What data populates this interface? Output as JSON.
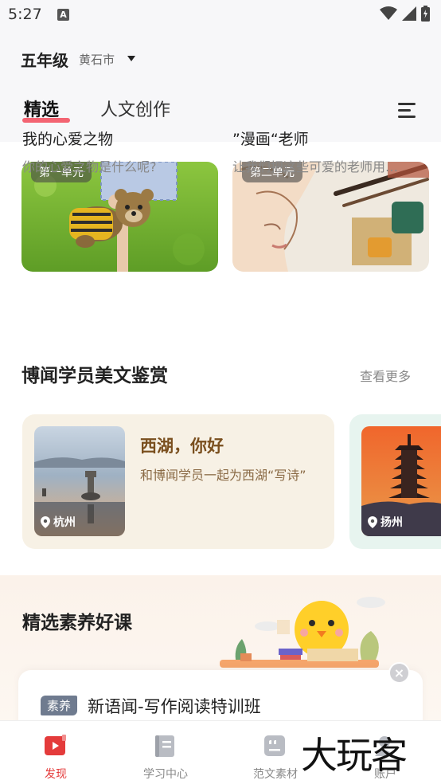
{
  "status_bar": {
    "time": "5:27",
    "notif_glyph": "A",
    "icons": [
      "wifi-icon",
      "signal-icon",
      "battery-icon"
    ]
  },
  "header": {
    "grade": "五年级",
    "city": "黄石市",
    "tabs": [
      {
        "label": "精选",
        "active": true
      },
      {
        "label": "人文创作",
        "active": false
      }
    ]
  },
  "units": [
    {
      "badge": "第一单元",
      "title": "我的心爱之物",
      "subtitle": "你的心爱之物是什么呢?"
    },
    {
      "badge": "第二单元",
      "title": "”漫画“老师",
      "subtitle": "让我们把这些可爱的老师用…"
    }
  ],
  "essays_section": {
    "title": "博闻学员美文鉴赏",
    "see_more": "查看更多",
    "cards": [
      {
        "location": "杭州",
        "title": "西湖，你好",
        "desc": "和博闻学员一起为西湖“写诗”"
      },
      {
        "location": "扬州"
      }
    ]
  },
  "courses_section": {
    "title": "精选素养好课",
    "course": {
      "badge": "素养",
      "name": "新语闻-写作阅读特训班"
    },
    "close": "×"
  },
  "bottom_nav": [
    {
      "label": "发现",
      "icon": "discover-icon",
      "active": true
    },
    {
      "label": "学习中心",
      "icon": "study-center-icon",
      "active": false
    },
    {
      "label": "范文素材",
      "icon": "sample-essay-icon",
      "active": false
    },
    {
      "label": "账户",
      "icon": "account-icon",
      "active": false
    }
  ],
  "watermark": "大玩客",
  "colors": {
    "accent": "#e43b3b",
    "essay_card_bg": "#f7f1e5",
    "essay_title": "#7a4f1e"
  }
}
